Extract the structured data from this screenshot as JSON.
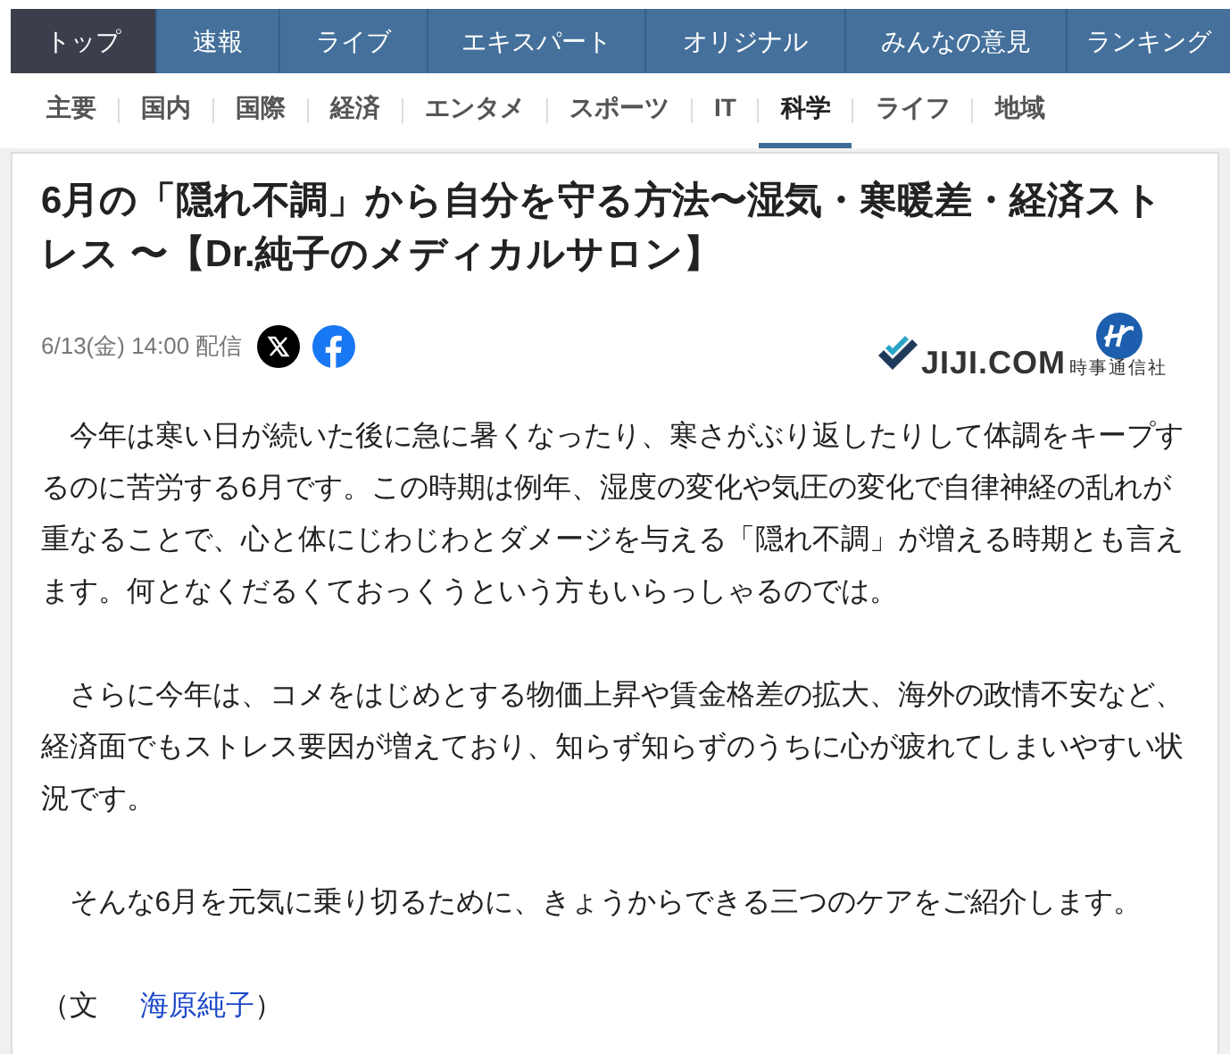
{
  "main_nav": [
    {
      "label": "トップ",
      "selected": true
    },
    {
      "label": "速報",
      "selected": false
    },
    {
      "label": "ライブ",
      "selected": false
    },
    {
      "label": "エキスパート",
      "selected": false
    },
    {
      "label": "オリジナル",
      "selected": false
    },
    {
      "label": "みんなの意見",
      "selected": false
    },
    {
      "label": "ランキング",
      "selected": false
    }
  ],
  "category_nav": [
    {
      "label": "主要",
      "selected": false
    },
    {
      "label": "国内",
      "selected": false
    },
    {
      "label": "国際",
      "selected": false
    },
    {
      "label": "経済",
      "selected": false
    },
    {
      "label": "エンタメ",
      "selected": false
    },
    {
      "label": "スポーツ",
      "selected": false
    },
    {
      "label": "IT",
      "selected": false
    },
    {
      "label": "科学",
      "selected": true
    },
    {
      "label": "ライフ",
      "selected": false
    },
    {
      "label": "地域",
      "selected": false
    }
  ],
  "article": {
    "title": "6月の「隠れ不調」から自分を守る方法〜湿気・寒暖差・経済ストレス 〜【Dr.純子のメディカルサロン】",
    "date": "6/13(金) 14:00 配信",
    "source": {
      "brand": "JIJI.COM",
      "company": "時事通信社"
    },
    "paragraphs": [
      "今年は寒い日が続いた後に急に暑くなったり、寒さがぶり返したりして体調をキープするのに苦労する6月です。この時期は例年、湿度の変化や気圧の変化で自律神経の乱れが重なることで、心と体にじわじわとダメージを与える「隠れ不調」が増える時期とも言えます。何となくだるくておっくうという方もいらっしゃるのでは。",
      "さらに今年は、コメをはじめとする物価上昇や賃金格差の拡大、海外の政情不安など、経済面でもストレス要因が増えており、知らず知らずのうちに心が疲れてしまいやすい状況です。",
      "そんな6月を元気に乗り切るために、きょうからできる三つのケアをご紹介します。"
    ],
    "byline": {
      "prefix": "（文",
      "author": "海原純子",
      "suffix": "）"
    }
  }
}
